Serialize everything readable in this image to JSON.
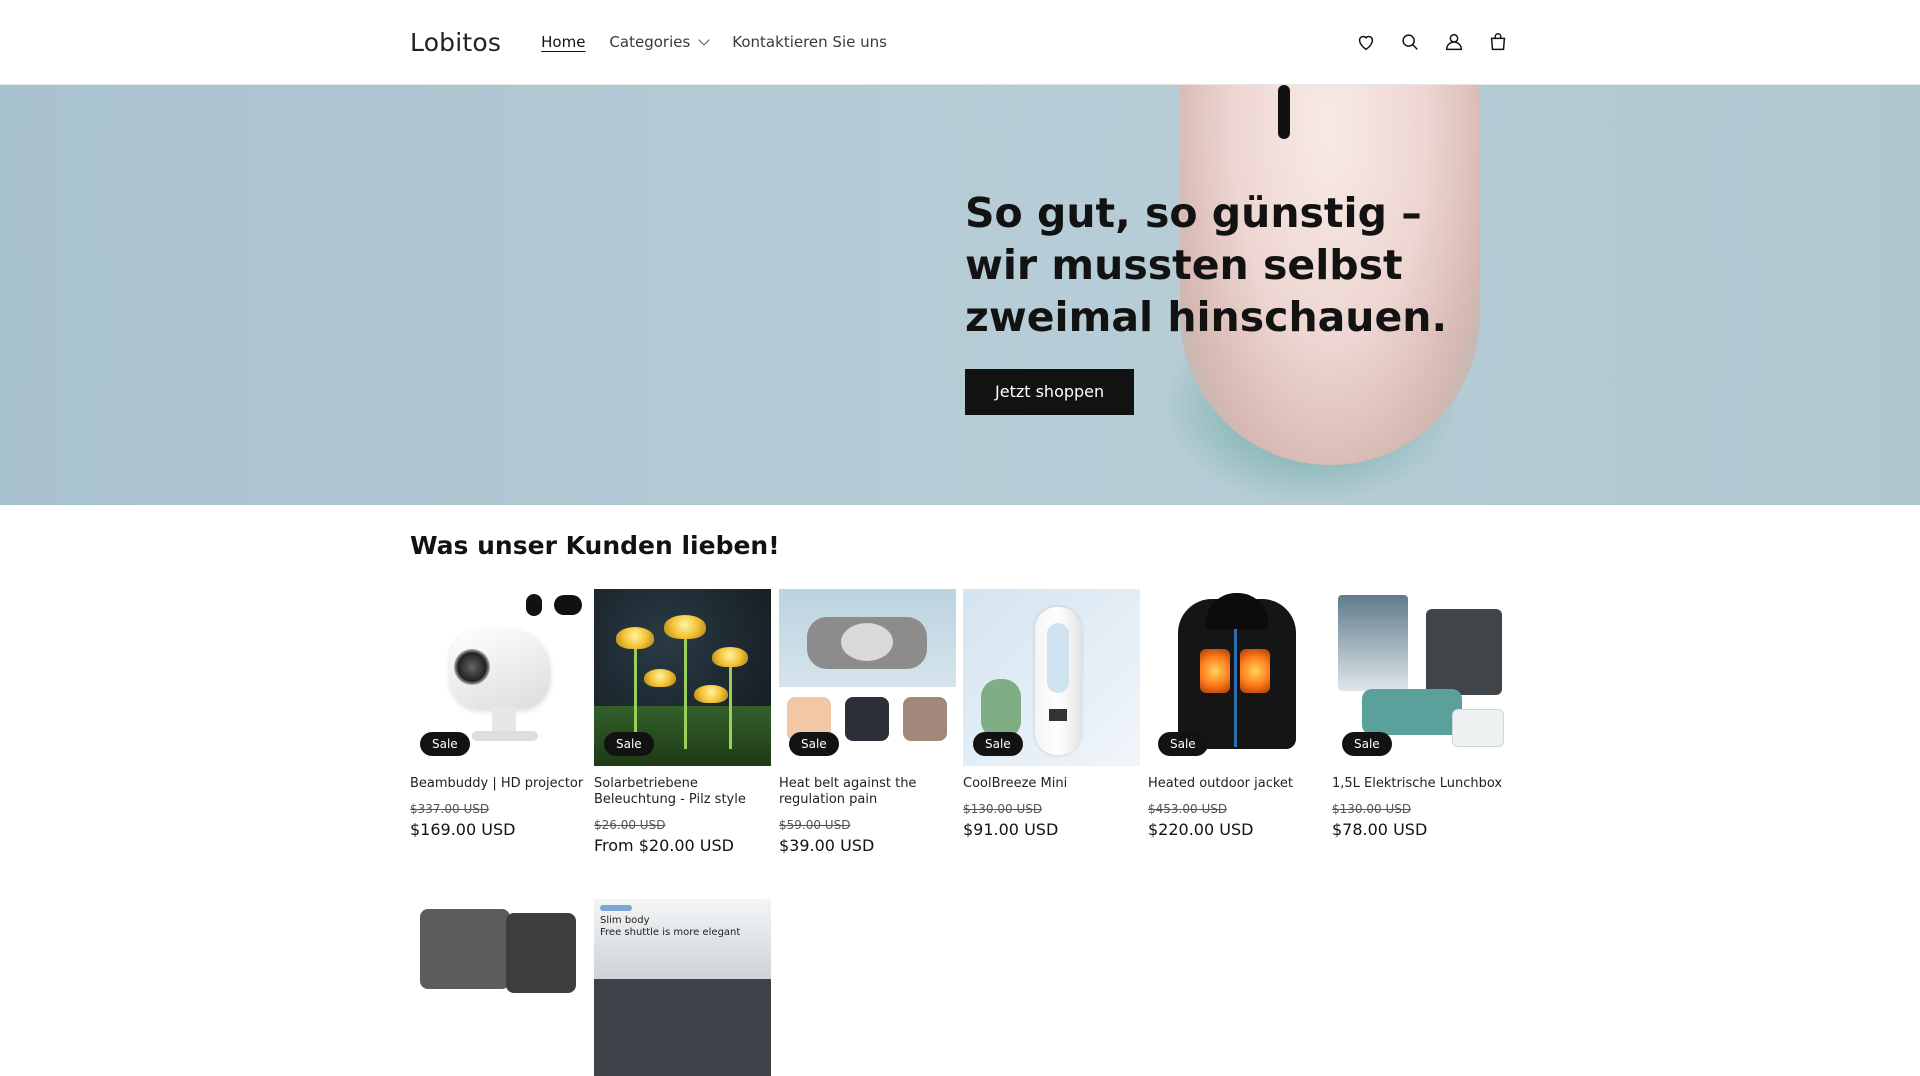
{
  "header": {
    "logo": "Lobitos",
    "nav": [
      {
        "label": "Home"
      },
      {
        "label": "Categories"
      },
      {
        "label": "Kontaktieren Sie uns"
      }
    ],
    "icons": [
      "heart-icon",
      "search-icon",
      "account-icon",
      "cart-icon"
    ]
  },
  "hero": {
    "title": "So gut, so günstig – wir mussten selbst zweimal hinschauen.",
    "button": "Jetzt shoppen"
  },
  "section": {
    "title": "Was unser Kunden lieben!",
    "products": [
      {
        "name": "Beambuddy | HD projector",
        "badge": "Sale",
        "old_price": "$337.00 USD",
        "price": "$169.00 USD"
      },
      {
        "name": "Solarbetriebene Beleuchtung - Pilz style",
        "badge": "Sale",
        "old_price": "$26.00 USD",
        "price": "From $20.00 USD"
      },
      {
        "name": "Heat belt against the regulation pain",
        "badge": "Sale",
        "old_price": "$59.00 USD",
        "price": "$39.00 USD"
      },
      {
        "name": "CoolBreeze Mini",
        "badge": "Sale",
        "old_price": "$130.00 USD",
        "price": "$91.00 USD"
      },
      {
        "name": "Heated outdoor jacket",
        "badge": "Sale",
        "old_price": "$453.00 USD",
        "price": "$220.00 USD"
      },
      {
        "name": "1,5L Elektrische Lunchbox",
        "badge": "Sale",
        "old_price": "$130.00 USD",
        "price": "$78.00 USD"
      }
    ],
    "row2_thumb_text": [
      "Slim body",
      "Free shuttle is more elegant"
    ]
  },
  "colors": {
    "accent": "#121212",
    "hero_bg": "#b3c9d4"
  }
}
